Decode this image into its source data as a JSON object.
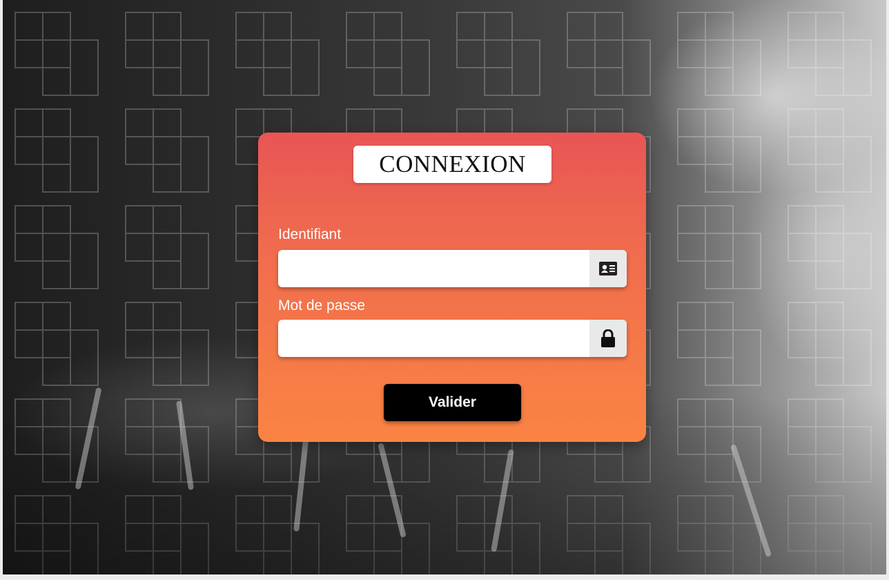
{
  "login": {
    "title": "CONNEXION",
    "username": {
      "label": "Identifiant",
      "value": "",
      "icon": "id-card-icon"
    },
    "password": {
      "label": "Mot de passe",
      "value": "",
      "icon": "lock-icon"
    },
    "submit_label": "Valider"
  },
  "colors": {
    "card_gradient_top": "#e85555",
    "card_gradient_bottom": "#fb8443",
    "button_bg": "#000000",
    "addon_bg": "#e9e9e9"
  }
}
